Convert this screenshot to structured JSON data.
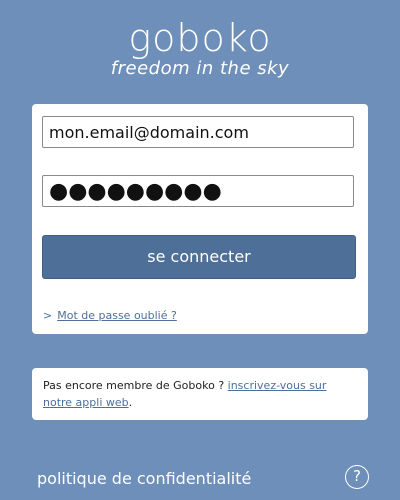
{
  "brand": {
    "logo_text": "goboko",
    "tagline": "freedom in the sky"
  },
  "login": {
    "email_value": "mon.email@domain.com",
    "password_value": "●●●●●●●●●",
    "connect_label": "se connecter",
    "forgot_chevron": ">",
    "forgot_label": "Mot de passe oublié ?"
  },
  "signup": {
    "prompt_text": "Pas encore membre de Goboko ? ",
    "link_text": "inscrivez-vous sur notre appli web",
    "end_punct": "."
  },
  "footer": {
    "privacy_label": "politique de confidentialité",
    "help_label": "?"
  },
  "colors": {
    "background": "#6d8fb9",
    "button": "#4e6f97",
    "link": "#4e6f97"
  }
}
